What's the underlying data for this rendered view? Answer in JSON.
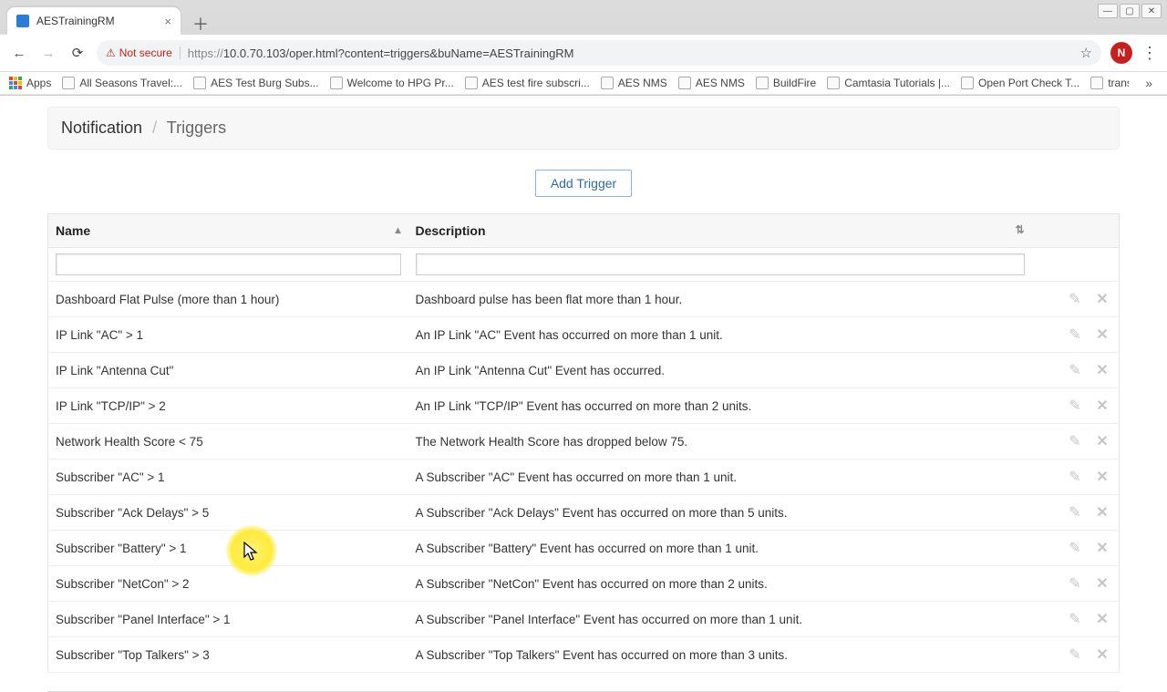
{
  "browser": {
    "tab_title": "AESTrainingRM",
    "url_protocol": "https://",
    "url_rest": "10.0.70.103/oper.html?content=triggers&buName=AESTrainingRM",
    "not_secure_label": "Not secure",
    "avatar_initial": "N"
  },
  "bookmarks": {
    "apps_label": "Apps",
    "items": [
      "All Seasons Travel:...",
      "AES Test Burg Subs...",
      "Welcome to HPG Pr...",
      "AES test fire subscri...",
      "AES NMS",
      "AES NMS",
      "BuildFire",
      "Camtasia Tutorials |...",
      "Open Port Check T...",
      "transtatus.transgro..."
    ]
  },
  "breadcrumb": {
    "root": "Notification",
    "leaf": "Triggers"
  },
  "buttons": {
    "add_trigger": "Add Trigger"
  },
  "columns": {
    "name": "Name",
    "description": "Description"
  },
  "filters": {
    "name_value": "",
    "desc_value": ""
  },
  "rows": [
    {
      "name": "Dashboard Flat Pulse (more than 1 hour)",
      "description": "Dashboard pulse has been flat more than 1 hour."
    },
    {
      "name": "IP Link \"AC\" > 1",
      "description": "An IP Link \"AC\" Event has occurred on more than 1 unit."
    },
    {
      "name": "IP Link \"Antenna Cut\"",
      "description": "An IP Link \"Antenna Cut\" Event has occurred."
    },
    {
      "name": "IP Link \"TCP/IP\" > 2",
      "description": "An IP Link \"TCP/IP\" Event has occurred on more than 2 units."
    },
    {
      "name": "Network Health Score < 75",
      "description": "The Network Health Score has dropped below 75."
    },
    {
      "name": "Subscriber \"AC\" > 1",
      "description": "A Subscriber \"AC\" Event has occurred on more than 1 unit."
    },
    {
      "name": "Subscriber \"Ack Delays\" > 5",
      "description": "A Subscriber \"Ack Delays\" Event has occurred on more than 5 units."
    },
    {
      "name": "Subscriber \"Battery\" > 1",
      "description": "A Subscriber \"Battery\" Event has occurred on more than 1 unit."
    },
    {
      "name": "Subscriber \"NetCon\" > 2",
      "description": "A Subscriber \"NetCon\" Event has occurred on more than 2 units."
    },
    {
      "name": "Subscriber \"Panel Interface\" > 1",
      "description": "A Subscriber \"Panel Interface\" Event has occurred on more than 1 unit."
    },
    {
      "name": "Subscriber \"Top Talkers\" > 3",
      "description": "A Subscriber \"Top Talkers\" Event has occurred on more than 3 units."
    }
  ]
}
